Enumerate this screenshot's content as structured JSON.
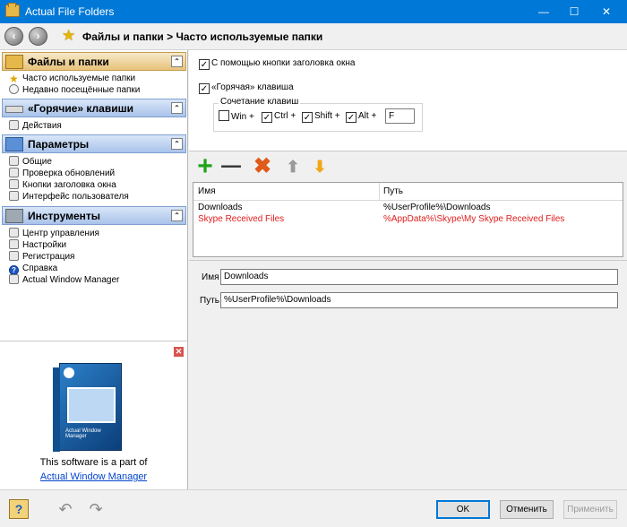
{
  "window": {
    "title": "Actual File Folders",
    "minimize_glyph": "—",
    "maximize_glyph": "☐",
    "close_glyph": "✕"
  },
  "toolbar": {
    "back_glyph": "‹",
    "forward_glyph": "›",
    "breadcrumb": "Файлы и папки > Часто используемые папки"
  },
  "sidebar": {
    "groups": [
      {
        "label": "Файлы и папки",
        "collapse_glyph": "⌃",
        "items": [
          "Часто используемые папки",
          "Недавно посещённые папки"
        ]
      },
      {
        "label": "«Горячие» клавиши",
        "collapse_glyph": "⌃",
        "items": [
          "Действия"
        ]
      },
      {
        "label": "Параметры",
        "collapse_glyph": "⌃",
        "items": [
          "Общие",
          "Проверка обновлений",
          "Кнопки заголовка окна",
          "Интерфейс пользователя"
        ]
      },
      {
        "label": "Инструменты",
        "collapse_glyph": "⌃",
        "items": [
          "Центр управления",
          "Настройки",
          "Регистрация",
          "Справка",
          "Actual Window Manager"
        ]
      }
    ],
    "ad": {
      "close_glyph": "✕",
      "box_text": "Actual Window Manager",
      "caption": "This software is a part of",
      "link": "Actual Window Manager"
    }
  },
  "options": {
    "title_button_label": "С помощью кнопки заголовка окна",
    "title_button_checked": true,
    "hotkey_label": "«Горячая» клавиша",
    "hotkey_checked": true,
    "combo_legend": "Сочетание клавиш",
    "modifiers": [
      {
        "label": "Win +",
        "checked": false
      },
      {
        "label": "Ctrl +",
        "checked": true
      },
      {
        "label": "Shift +",
        "checked": true
      },
      {
        "label": "Alt +",
        "checked": true
      }
    ],
    "key_value": "F",
    "check_glyph": "✓"
  },
  "list_toolbar": {
    "add_glyph": "+",
    "remove_glyph": "−−",
    "delete_glyph": "✖",
    "up_glyph": "⬆",
    "down_glyph": "⬇"
  },
  "folders_table": {
    "columns": [
      "Имя",
      "Путь"
    ],
    "rows": [
      {
        "name": "Downloads",
        "path": "%UserProfile%\\Downloads",
        "highlight": false
      },
      {
        "name": "Skype Received Files",
        "path": "%AppData%\\Skype\\My Skype Received Files",
        "highlight": true
      }
    ],
    "highlight_color": "#e21c1c"
  },
  "details": {
    "name_label": "Имя",
    "name_value": "Downloads",
    "path_label": "Путь",
    "path_value": "%UserProfile%\\Downloads"
  },
  "footer": {
    "help_glyph": "?",
    "undo_glyph": "↶",
    "redo_glyph": "↷",
    "ok": "OK",
    "cancel": "Отменить",
    "apply": "Применить"
  },
  "colors": {
    "titlebar": "#0078d7",
    "group_header_gold": "#e7c27a",
    "group_header_blue": "#a9c3ea",
    "link": "#0044cc"
  }
}
